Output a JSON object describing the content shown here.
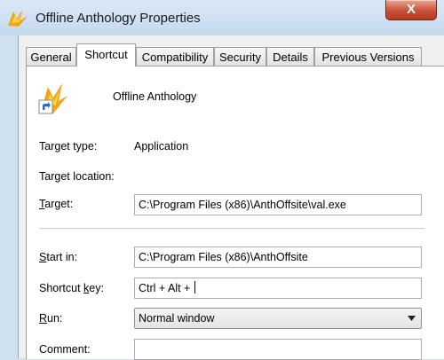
{
  "window": {
    "title": "Offline Anthology Properties",
    "close_glyph": "X",
    "icon": "app-icon"
  },
  "tabs": [
    {
      "label": "General"
    },
    {
      "label": "Shortcut"
    },
    {
      "label": "Compatibility"
    },
    {
      "label": "Security"
    },
    {
      "label": "Details"
    },
    {
      "label": "Previous Versions"
    }
  ],
  "active_tab": "Shortcut",
  "shortcut": {
    "name": "Offline Anthology",
    "icon": "app-icon",
    "target_type_label": "Target type:",
    "target_type_value": "Application",
    "target_location_label": "Target location:",
    "target_label_mnemonic": "T",
    "target_label_rest": "arget:",
    "target_value": "C:\\Program Files (x86)\\AnthOffsite\\val.exe",
    "start_in_label_mnemonic": "S",
    "start_in_label_rest": "tart in:",
    "start_in_value": "C:\\Program Files (x86)\\AnthOffsite",
    "shortcut_key_label_pre": "Shortcut ",
    "shortcut_key_label_mnemonic": "k",
    "shortcut_key_label_post": "ey:",
    "shortcut_key_value": "Ctrl + Alt + ",
    "run_label_mnemonic": "R",
    "run_label_rest": "un:",
    "run_value": "Normal window",
    "comment_label": "Comment:",
    "comment_value": ""
  },
  "colors": {
    "titlebar": "#cfe0f1",
    "close_button": "#c9503a",
    "panel": "#ffffff"
  }
}
